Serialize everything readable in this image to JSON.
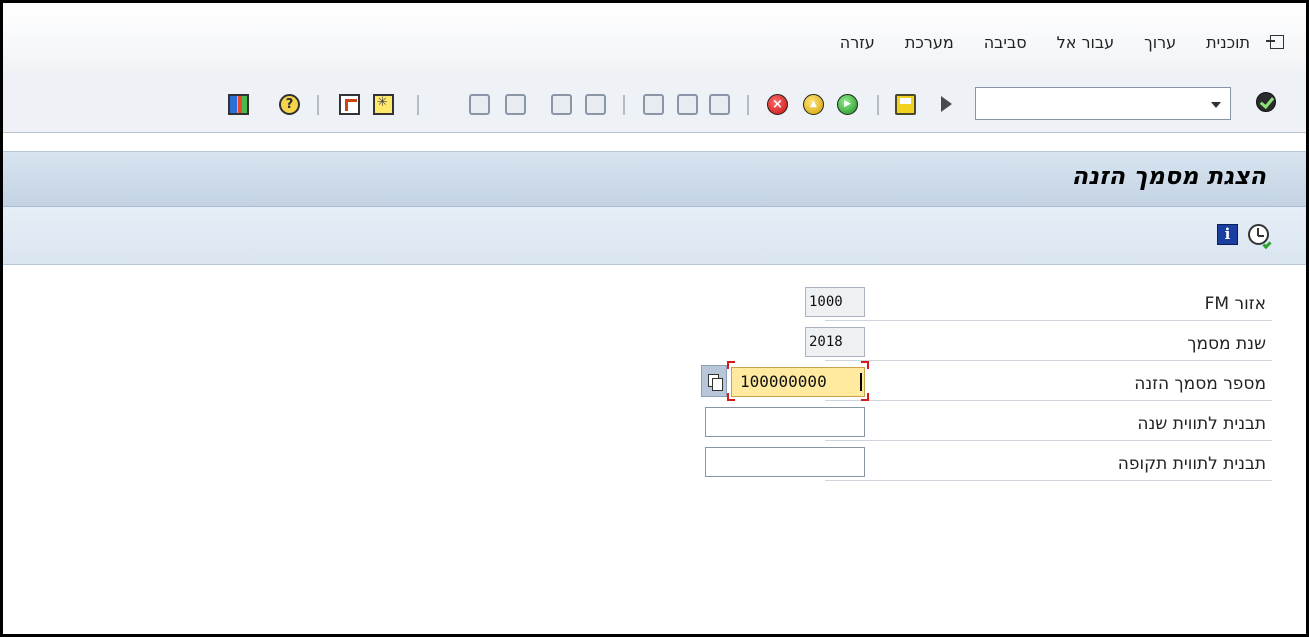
{
  "menu": {
    "items": [
      "תוכנית",
      "ערוך",
      "עבור אל",
      "סביבה",
      "מערכת",
      "עזרה"
    ]
  },
  "toolbar": {
    "command_field_value": "",
    "icons": [
      "ok-icon",
      "command-dropdown",
      "save-icon",
      "play-icon",
      "back-icon",
      "exit-icon",
      "cancel-icon",
      "print-icon",
      "find-icon",
      "find-next-icon",
      "first-page-icon",
      "previous-page-icon",
      "next-page-icon",
      "last-page-icon",
      "create-session-icon",
      "shortcut-icon",
      "help-icon",
      "layout-icon"
    ]
  },
  "title": "הצגת מסמך הזנה",
  "app_toolbar": {
    "icons": [
      "execute-icon",
      "info-icon"
    ]
  },
  "form": {
    "fm_area": {
      "label": "אזור FM",
      "value": "1000"
    },
    "doc_year": {
      "label": "שנת מסמך",
      "value": "2018"
    },
    "doc_number": {
      "label": "מספר מסמך הזנה",
      "value": "100000000"
    },
    "year_template": {
      "label": "תבנית לתווית שנה",
      "value": ""
    },
    "period_template": {
      "label": "תבנית לתווית תקופה",
      "value": ""
    }
  },
  "colors": {
    "title_bar": "#c3d3e3",
    "active_field": "#ffeaa0",
    "focus_corner": "#d61b1b"
  }
}
